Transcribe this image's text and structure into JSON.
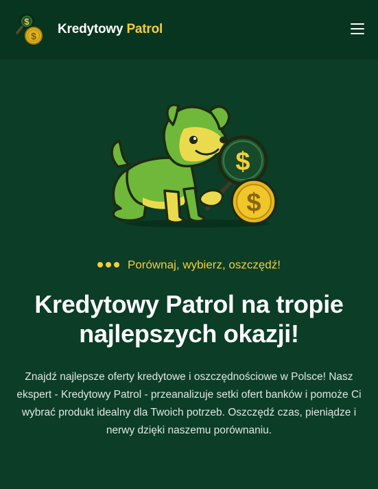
{
  "header": {
    "brand_main": "Kredytowy",
    "brand_accent": "Patrol",
    "logo_icon": "magnifier-coin-icon",
    "menu_icon": "hamburger-menu-icon"
  },
  "hero": {
    "image": "dog-with-magnifier-and-coin-illustration",
    "tagline": "Porównaj, wybierz, oszczędź!",
    "title": "Kredytowy Patrol na tropie najlepszych okazji!",
    "description": "Znajdź najlepsze oferty kredytowe i oszczędnościowe w Polsce! Nasz ekspert - Kredytowy Patrol - przeanalizuje setki ofert banków i pomoże Ci wybrać produkt idealny dla Twoich potrzeb. Oszczędź czas, pieniądze i nerwy dzięki naszemu porównaniu."
  },
  "colors": {
    "background": "#0b3d27",
    "header_background": "#073520",
    "accent": "#f3cf3a",
    "text": "#ffffff"
  }
}
